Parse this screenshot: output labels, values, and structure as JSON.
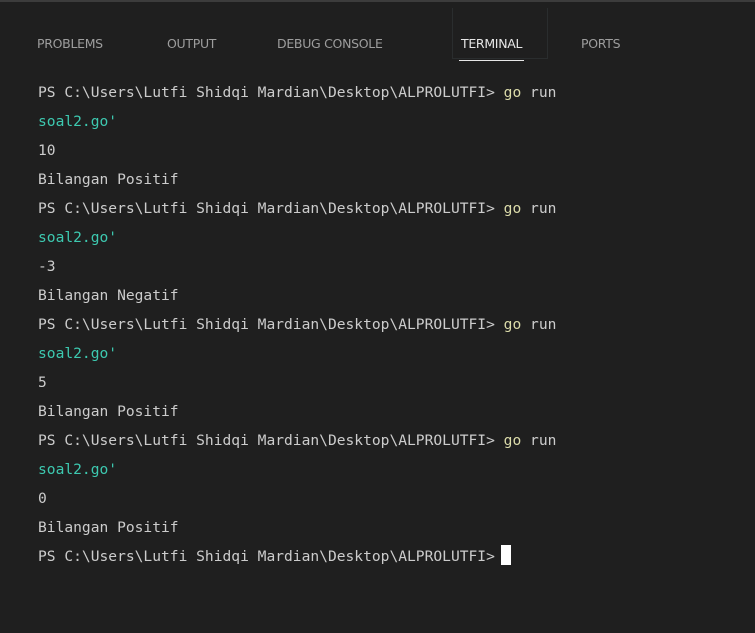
{
  "tabs": [
    {
      "label": "PROBLEMS",
      "active": false
    },
    {
      "label": "OUTPUT",
      "active": false
    },
    {
      "label": "DEBUG CONSOLE",
      "active": false
    },
    {
      "label": "TERMINAL",
      "active": true
    },
    {
      "label": "PORTS",
      "active": false
    }
  ],
  "terminal": {
    "lines": [
      {
        "prompt": "PS C:\\Users\\Lutfi Shidqi Mardian\\Desktop\\ALPROLUTFI> ",
        "command": "go",
        "rest": " run"
      },
      {
        "continuation": "soal2.go'"
      },
      {
        "output": "10"
      },
      {
        "output": "Bilangan Positif"
      },
      {
        "prompt": "PS C:\\Users\\Lutfi Shidqi Mardian\\Desktop\\ALPROLUTFI> ",
        "command": "go",
        "rest": " run"
      },
      {
        "continuation": "soal2.go'"
      },
      {
        "output": "-3"
      },
      {
        "output": "Bilangan Negatif"
      },
      {
        "prompt": "PS C:\\Users\\Lutfi Shidqi Mardian\\Desktop\\ALPROLUTFI> ",
        "command": "go",
        "rest": " run"
      },
      {
        "continuation": "soal2.go'"
      },
      {
        "output": "5"
      },
      {
        "output": "Bilangan Positif"
      },
      {
        "prompt": "PS C:\\Users\\Lutfi Shidqi Mardian\\Desktop\\ALPROLUTFI> ",
        "command": "go",
        "rest": " run"
      },
      {
        "continuation": "soal2.go'"
      },
      {
        "output": "0"
      },
      {
        "output": "Bilangan Positif"
      },
      {
        "prompt": "PS C:\\Users\\Lutfi Shidqi Mardian\\Desktop\\ALPROLUTFI>",
        "cursor": true
      }
    ]
  },
  "colors": {
    "background": "#1f1f1f",
    "text": "#cccccc",
    "command": "#dcdcaa",
    "continuation": "#3dc9b0",
    "tab_inactive": "#9d9d9d",
    "tab_active": "#e7e7e7"
  }
}
